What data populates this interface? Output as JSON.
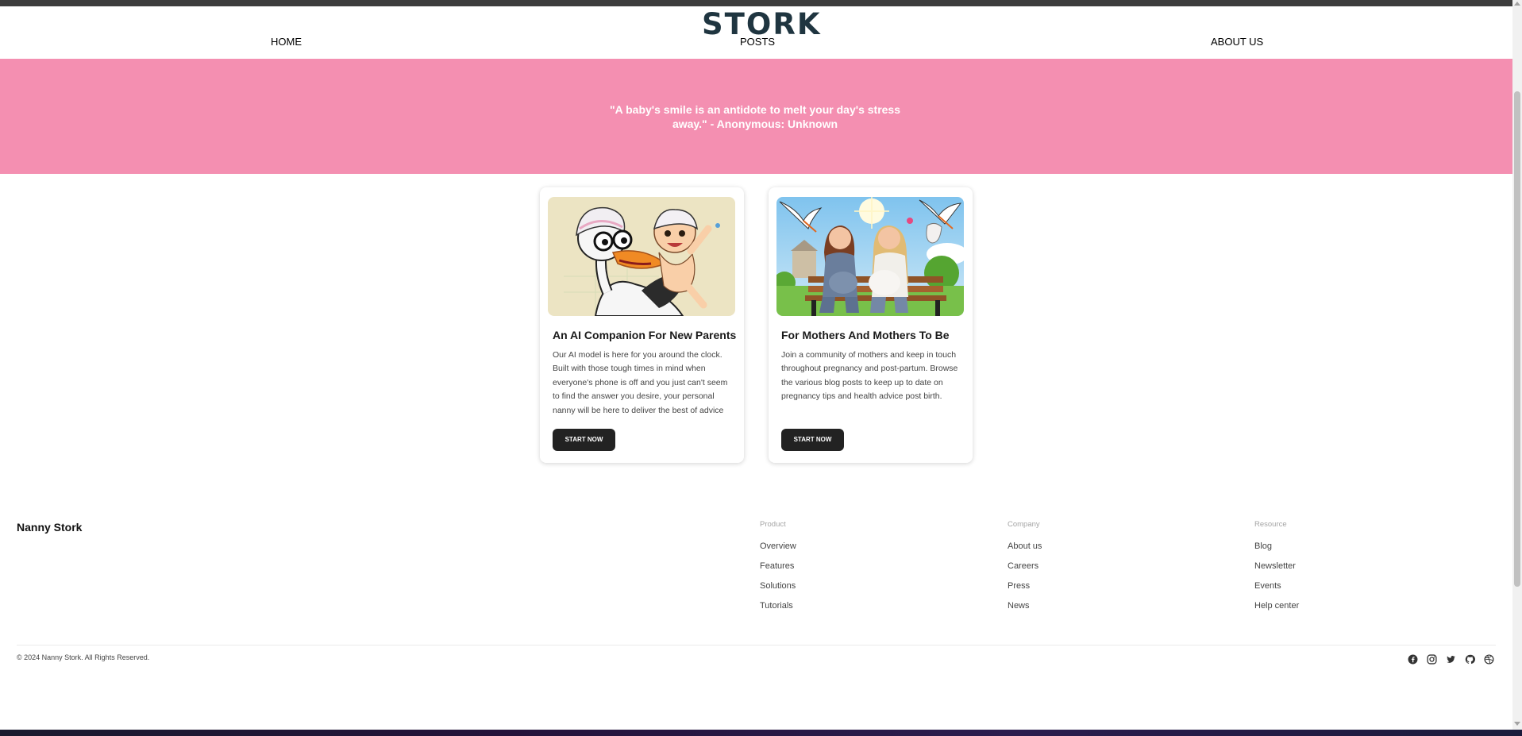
{
  "header": {
    "logo": "STORK",
    "nav": [
      "HOME",
      "POSTS",
      "ABOUT US"
    ]
  },
  "hero": {
    "quote": "\"A baby's smile is an antidote to melt your day's stress away.\" - Anonymous: Unknown"
  },
  "cards": [
    {
      "title": "An AI Companion For New Parents",
      "description": "Our AI model is here for you around the clock. Built with those tough times in mind when everyone's phone is off and you just can't seem to find the answer you desire, your personal nanny will be here to deliver the best of advice",
      "button": "START NOW",
      "image": "stork-nanny-with-baby-illustration"
    },
    {
      "title": "For Mothers And Mothers To Be",
      "description": "Join a community of mothers and keep in touch throughout pregnancy and post-partum. Browse the various blog posts to keep up to date on pregnancy tips and health advice post birth.",
      "button": "START NOW",
      "image": "pregnant-mothers-on-bench-with-storks-illustration"
    }
  ],
  "footer": {
    "brand": "Nanny Stork",
    "columns": [
      {
        "title": "Product",
        "links": [
          "Overview",
          "Features",
          "Solutions",
          "Tutorials"
        ]
      },
      {
        "title": "Company",
        "links": [
          "About us",
          "Careers",
          "Press",
          "News"
        ]
      },
      {
        "title": "Resource",
        "links": [
          "Blog",
          "Newsletter",
          "Events",
          "Help center"
        ]
      }
    ],
    "copyright": "© 2024 Nanny Stork. All Rights Reserved.",
    "social_icons": [
      "facebook-icon",
      "instagram-icon",
      "twitter-icon",
      "github-icon",
      "dribbble-icon"
    ]
  },
  "colors": {
    "hero_bg": "#f48fb1",
    "button_bg": "#222222",
    "logo": "#1f3540"
  }
}
